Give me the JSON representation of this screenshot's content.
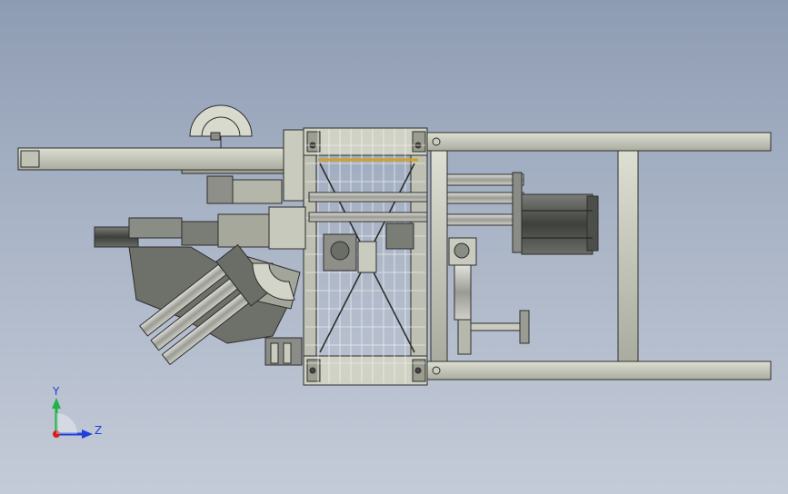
{
  "triad": {
    "y_label": "Y",
    "z_label": "Z",
    "y_color": "#22b14c",
    "z_color": "#1f3fd8",
    "x_color": "#d02020"
  },
  "colors": {
    "background_top": "#8e9cb3",
    "background_bottom": "#c4cbd8",
    "frame_fill": "#c9ccbc",
    "frame_stroke": "#2e2e2e",
    "machine_dark": "#5a5c58",
    "machine_mid": "#8a8c86",
    "accent_orange": "#d4a020"
  },
  "icons": [
    "axis-triad-icon"
  ]
}
